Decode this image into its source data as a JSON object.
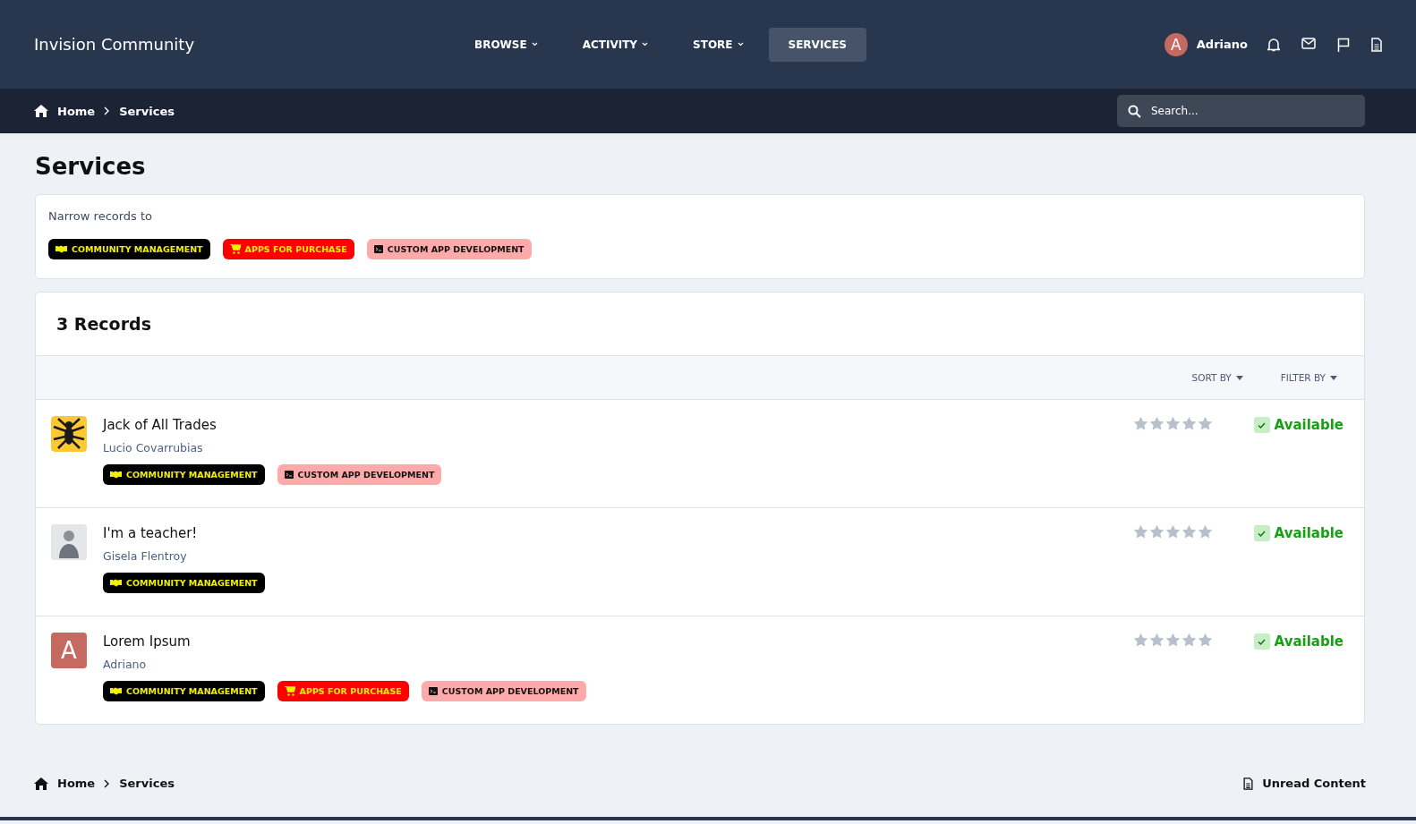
{
  "header": {
    "site_title": "Invision Community",
    "nav": [
      {
        "label": "BROWSE",
        "has_menu": true,
        "selected": false
      },
      {
        "label": "ACTIVITY",
        "has_menu": true,
        "selected": false
      },
      {
        "label": "STORE",
        "has_menu": true,
        "selected": false
      },
      {
        "label": "SERVICES",
        "has_menu": false,
        "selected": true
      }
    ],
    "user": {
      "avatar_letter": "A",
      "name": "Adriano"
    }
  },
  "breadcrumb": [
    "Home",
    "Services"
  ],
  "search": {
    "placeholder": "Search..."
  },
  "page_title": "Services",
  "filter": {
    "label": "Narrow records to",
    "tags": [
      {
        "label": "COMMUNITY MANAGEMENT",
        "kind": "handshake",
        "color": "#000000"
      },
      {
        "label": "APPS FOR PURCHASE",
        "kind": "cart",
        "color": "#ff0000"
      },
      {
        "label": "CUSTOM APP DEVELOPMENT",
        "kind": "code",
        "color": "#ffaaaa"
      }
    ]
  },
  "records": {
    "title": "3 Records",
    "sort_label": "SORT BY",
    "filter_label": "FILTER BY",
    "items": [
      {
        "title": "Jack of All Trades",
        "author": "Lucio Covarrubias",
        "avatar": {
          "kind": "image"
        },
        "stars": 0,
        "status": "Available",
        "tags": [
          {
            "label": "COMMUNITY MANAGEMENT",
            "kind": "handshake",
            "color": "#000000"
          },
          {
            "label": "CUSTOM APP DEVELOPMENT",
            "kind": "code",
            "color": "#ffaaaa"
          }
        ]
      },
      {
        "title": "I'm a teacher!",
        "author": "Gisela Flentroy",
        "avatar": {
          "kind": "photo"
        },
        "stars": 0,
        "status": "Available",
        "tags": [
          {
            "label": "COMMUNITY MANAGEMENT",
            "kind": "handshake",
            "color": "#000000"
          }
        ]
      },
      {
        "title": "Lorem Ipsum",
        "author": "Adriano",
        "avatar": {
          "kind": "letter",
          "letter": "A"
        },
        "stars": 0,
        "status": "Available",
        "tags": [
          {
            "label": "COMMUNITY MANAGEMENT",
            "kind": "handshake",
            "color": "#000000"
          },
          {
            "label": "APPS FOR PURCHASE",
            "kind": "cart",
            "color": "#ff0000"
          },
          {
            "label": "CUSTOM APP DEVELOPMENT",
            "kind": "code",
            "color": "#ffaaaa"
          }
        ]
      }
    ]
  },
  "footer": {
    "breadcrumb": [
      "Home",
      "Services"
    ],
    "unread_label": "Unread Content"
  }
}
